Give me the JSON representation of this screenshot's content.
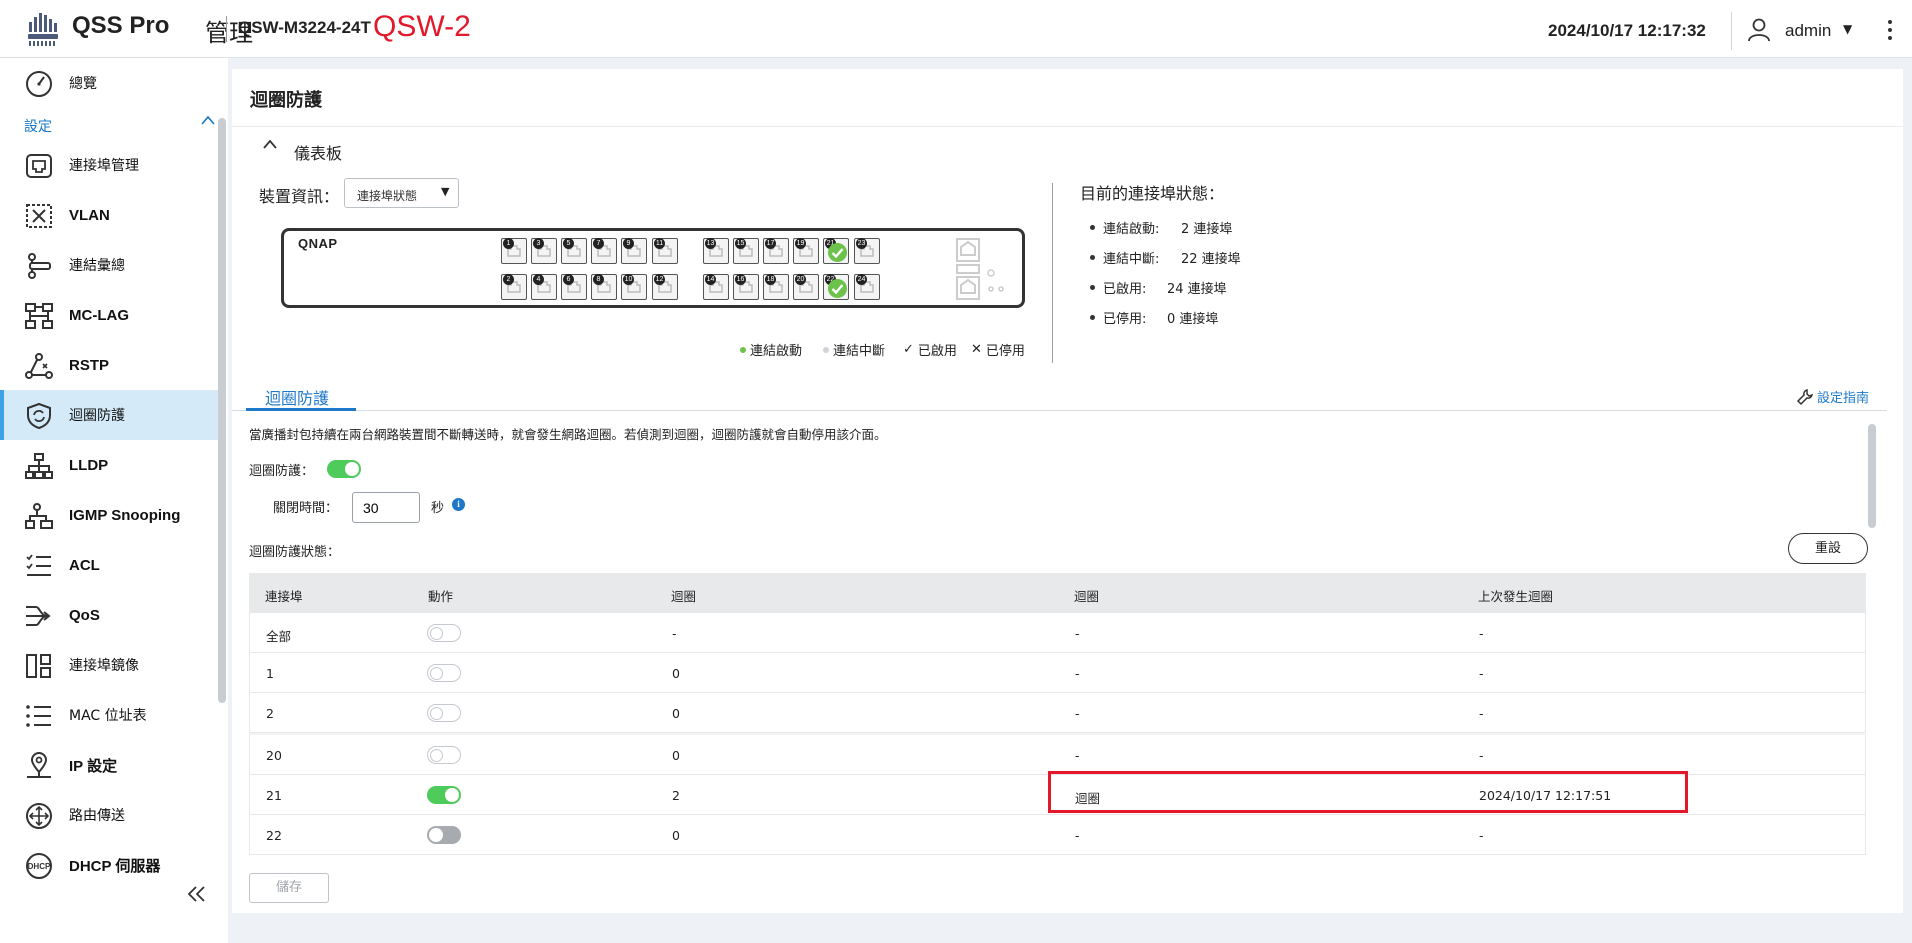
{
  "header": {
    "brand": "QSS Pro",
    "brand_sub": "管理",
    "model": "QSW-M3224-24T",
    "hostname": "QSW-2",
    "datetime": "2024/10/17 12:17:32",
    "user": "admin"
  },
  "sidebar": {
    "overview": "總覽",
    "settings_label": "設定",
    "items": [
      {
        "label": "連接埠管理",
        "icon": "port-icon"
      },
      {
        "label": "VLAN",
        "icon": "vlan-icon"
      },
      {
        "label": "連結彙總",
        "icon": "link-aggregation-icon"
      },
      {
        "label": "MC-LAG",
        "icon": "mc-lag-icon"
      },
      {
        "label": "RSTP",
        "icon": "rstp-icon"
      },
      {
        "label": "迴圈防護",
        "icon": "loop-protection-icon"
      },
      {
        "label": "LLDP",
        "icon": "lldp-icon"
      },
      {
        "label": "IGMP Snooping",
        "icon": "igmp-icon"
      },
      {
        "label": "ACL",
        "icon": "acl-icon"
      },
      {
        "label": "QoS",
        "icon": "qos-icon"
      },
      {
        "label": "連接埠鏡像",
        "icon": "port-mirror-icon"
      },
      {
        "label": "MAC 位址表",
        "icon": "mac-table-icon"
      },
      {
        "label": "IP 設定",
        "icon": "ip-settings-icon"
      },
      {
        "label": "路由傳送",
        "icon": "routing-icon"
      },
      {
        "label": "DHCP 伺服器",
        "icon": "dhcp-icon"
      }
    ]
  },
  "page": {
    "title": "迴圈防護",
    "dashboard": {
      "title": "儀表板",
      "device_info_label": "裝置資訊：",
      "device_info_selected": "連接埠狀態",
      "logo": "QNAP",
      "status_title": "目前的連接埠狀態：",
      "status": [
        {
          "label": "連結啟動:",
          "value": "2 連接埠"
        },
        {
          "label": "連結中斷:",
          "value": "22 連接埠"
        },
        {
          "label": "已啟用:",
          "value": "24 連接埠"
        },
        {
          "label": "已停用:",
          "value": "0 連接埠"
        }
      ],
      "legend": {
        "link_up": "連結啟動",
        "link_down": "連結中斷",
        "enabled": "已啟用",
        "disabled": "已停用",
        "up_color": "#6cc24a",
        "down_color": "#d0d3d7"
      },
      "ports_top": [
        "1",
        "3",
        "5",
        "7",
        "9",
        "11",
        "13",
        "15",
        "17",
        "19",
        "21",
        "23"
      ],
      "ports_bottom": [
        "2",
        "4",
        "6",
        "8",
        "10",
        "12",
        "14",
        "16",
        "18",
        "20",
        "22",
        "24"
      ],
      "ports_up": [
        "21",
        "22"
      ]
    },
    "tab": "迴圈防護",
    "guide": "設定指南",
    "description": "當廣播封包持續在兩台網路裝置間不斷轉送時，就會發生網路迴圈。若偵測到迴圈，迴圈防護就會自動停用該介面。",
    "loop_protection_label": "迴圈防護：",
    "loop_protection_enabled": true,
    "close_time_label": "關閉時間：",
    "close_time_value": "30",
    "close_time_unit": "秒",
    "status_label": "迴圈防護狀態：",
    "reset": "重設",
    "table": {
      "headers": [
        "連接埠",
        "動作",
        "迴圈",
        "迴圈",
        "上次發生迴圈"
      ],
      "rows": [
        {
          "port": "全部",
          "action": "off",
          "count": "-",
          "loop": "-",
          "last": "-"
        },
        {
          "port": "1",
          "action": "off",
          "count": "0",
          "loop": "-",
          "last": "-"
        },
        {
          "port": "2",
          "action": "off",
          "count": "0",
          "loop": "-",
          "last": "-"
        },
        {
          "port": "20",
          "action": "off",
          "count": "0",
          "loop": "-",
          "last": "-"
        },
        {
          "port": "21",
          "action": "on",
          "count": "2",
          "loop": "迴圈",
          "last": "2024/10/17  12:17:51"
        },
        {
          "port": "22",
          "action": "dark",
          "count": "0",
          "loop": "-",
          "last": "-"
        }
      ]
    },
    "save": "儲存"
  }
}
